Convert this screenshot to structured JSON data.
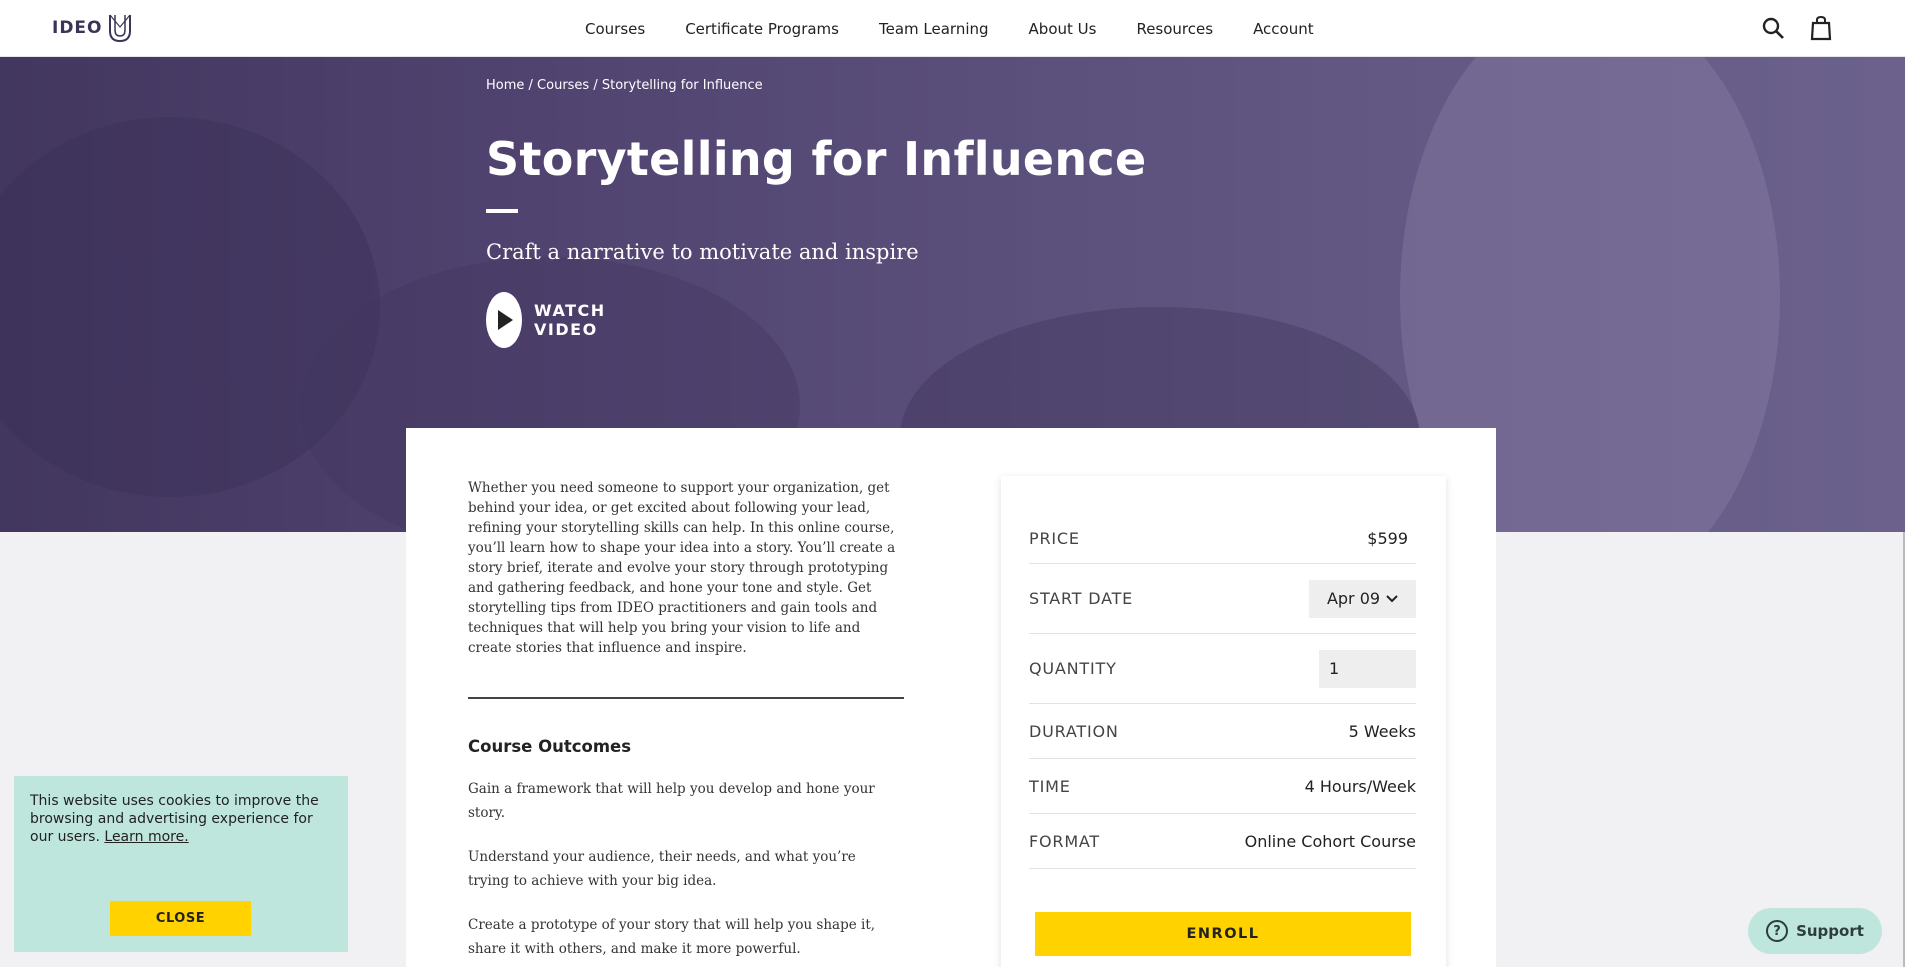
{
  "header": {
    "logo_text": "IDEO",
    "nav": [
      "Courses",
      "Certificate Programs",
      "Team Learning",
      "About Us",
      "Resources",
      "Account"
    ],
    "icons": [
      "search-icon",
      "cart-icon"
    ]
  },
  "hero": {
    "breadcrumb": [
      "Home",
      "Courses",
      "Storytelling for Influence"
    ],
    "breadcrumb_sep": " / ",
    "title": "Storytelling for Influence",
    "subtitle": "Craft a narrative to motivate and inspire",
    "watch_label": "WATCH VIDEO"
  },
  "main": {
    "description": "Whether you need someone to support your organization, get behind your idea, or get excited about following your lead, refining your storytelling skills can help. In this online course, you’ll learn how to shape your idea into a story. You’ll create a story brief, iterate and evolve your story through prototyping and gathering feedback, and hone your tone and style. Get storytelling tips from IDEO practitioners and gain tools and techniques that will help you bring your vision to life and create stories that influence and inspire.",
    "outcomes_title": "Course Outcomes",
    "outcomes": [
      "Gain a framework that will help you develop and hone your story.",
      "Understand your audience, their needs, and what you’re trying to achieve with your big idea.",
      "Create a prototype of your story that will help you shape it, share it with others, and make it more powerful."
    ]
  },
  "purchase": {
    "price_label": "PRICE",
    "price_value": "$599",
    "start_label": "START DATE",
    "start_value": "Apr 09",
    "quantity_label": "QUANTITY",
    "quantity_value": "1",
    "duration_label": "DURATION",
    "duration_value": "5 Weeks",
    "time_label": "TIME",
    "time_value": "4 Hours/Week",
    "format_label": "FORMAT",
    "format_value": "Online Cohort Course",
    "enroll_label": "ENROLL"
  },
  "cookie": {
    "text": "This website uses cookies to improve the browsing and advertising experience for our users.",
    "link": "Learn more.",
    "close_label": "CLOSE"
  },
  "support": {
    "label": "Support"
  },
  "colors": {
    "accent_yellow": "#ffd200",
    "mint": "#bfe6dc",
    "hero_purple": "#5a4f73"
  }
}
